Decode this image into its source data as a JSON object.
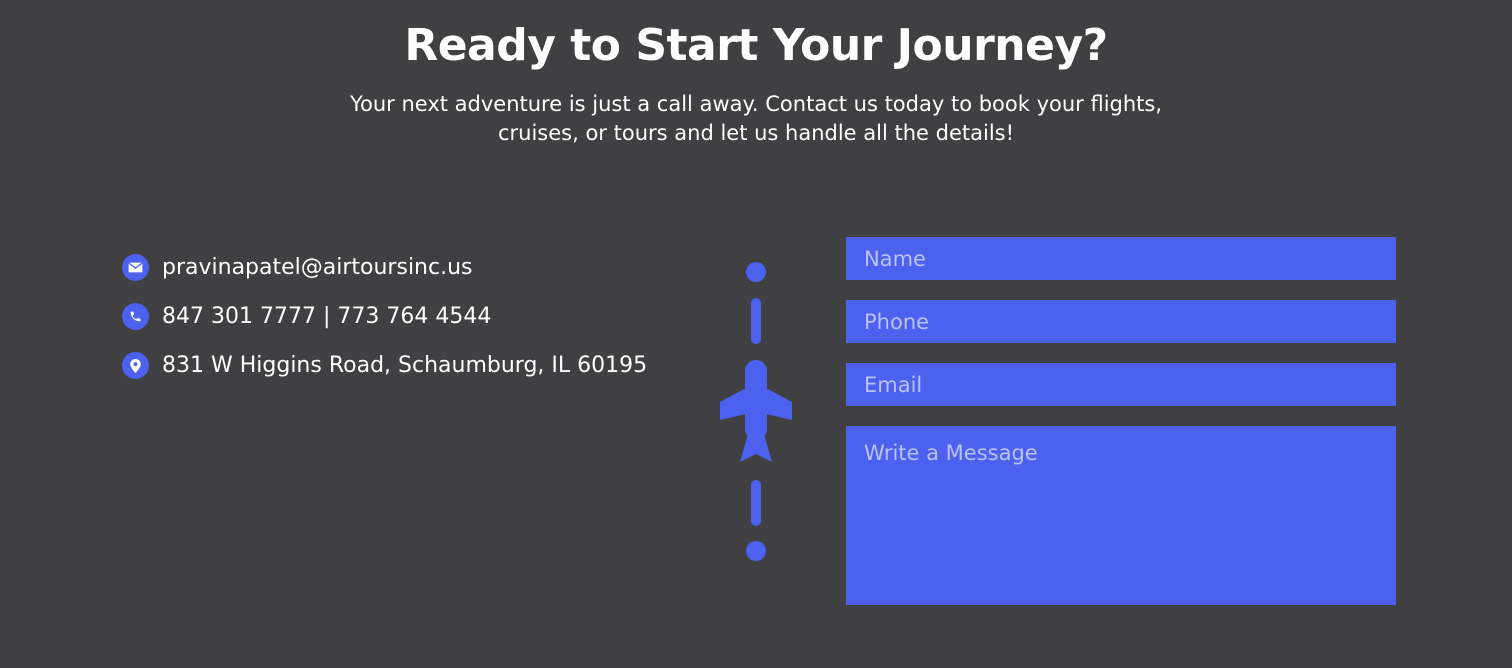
{
  "heading": "Ready to Start Your Journey?",
  "subtext": "Your next adventure is just a call away. Contact us today to book your flights, cruises, or tours and let us handle all the details!",
  "contact": {
    "email": "pravinapatel@airtoursinc.us",
    "phone": "847 301 7777 | 773 764 4544",
    "address": "831 W Higgins Road, Schaumburg, IL 60195"
  },
  "icons": {
    "email": "envelope-icon",
    "phone": "phone-icon",
    "address": "map-pin-icon",
    "divider": "airplane-icon"
  },
  "colors": {
    "background": "#404042",
    "accent": "#4d61ef",
    "text": "#ffffff",
    "placeholder": "#b9c2fb"
  },
  "form": {
    "name_placeholder": "Name",
    "phone_placeholder": "Phone",
    "email_placeholder": "Email",
    "message_placeholder": "Write a Message"
  }
}
